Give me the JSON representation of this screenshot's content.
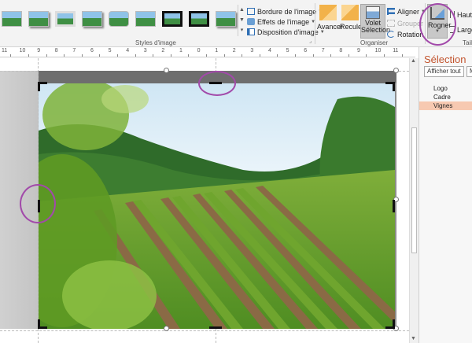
{
  "ribbon": {
    "picture_styles": {
      "group_label": "Styles d'image",
      "border_label": "Bordure de l'image",
      "effects_label": "Effets de l'image",
      "layout_label": "Disposition d'image"
    },
    "arrange": {
      "group_label": "Organiser",
      "bring_forward_label": "Avancer",
      "send_backward_label": "Reculer",
      "selection_pane_label_1": "Volet",
      "selection_pane_label_2": "Sélection",
      "align_label": "Aligner",
      "group_cmd_label": "Grouper",
      "rotate_label": "Rotation"
    },
    "size": {
      "group_label": "Tail",
      "crop_label": "Rogner",
      "height_label": "Haute",
      "width_label": "Large"
    }
  },
  "ruler": {
    "labels": [
      "11",
      "10",
      "9",
      "8",
      "7",
      "6",
      "5",
      "4",
      "3",
      "2",
      "1",
      "0",
      "1",
      "2",
      "3",
      "4",
      "5",
      "6",
      "7",
      "8",
      "9",
      "10",
      "11"
    ]
  },
  "selection_pane": {
    "title": "Sélection",
    "show_all_label": "Afficher tout",
    "hide_all_label": "M",
    "items": [
      "Logo",
      "Cadre",
      "Vignes"
    ],
    "selected_index": 2
  },
  "colors": {
    "accent": "#c2542e",
    "callout": "#a24aaa",
    "selected_row": "#f7c9b1"
  }
}
